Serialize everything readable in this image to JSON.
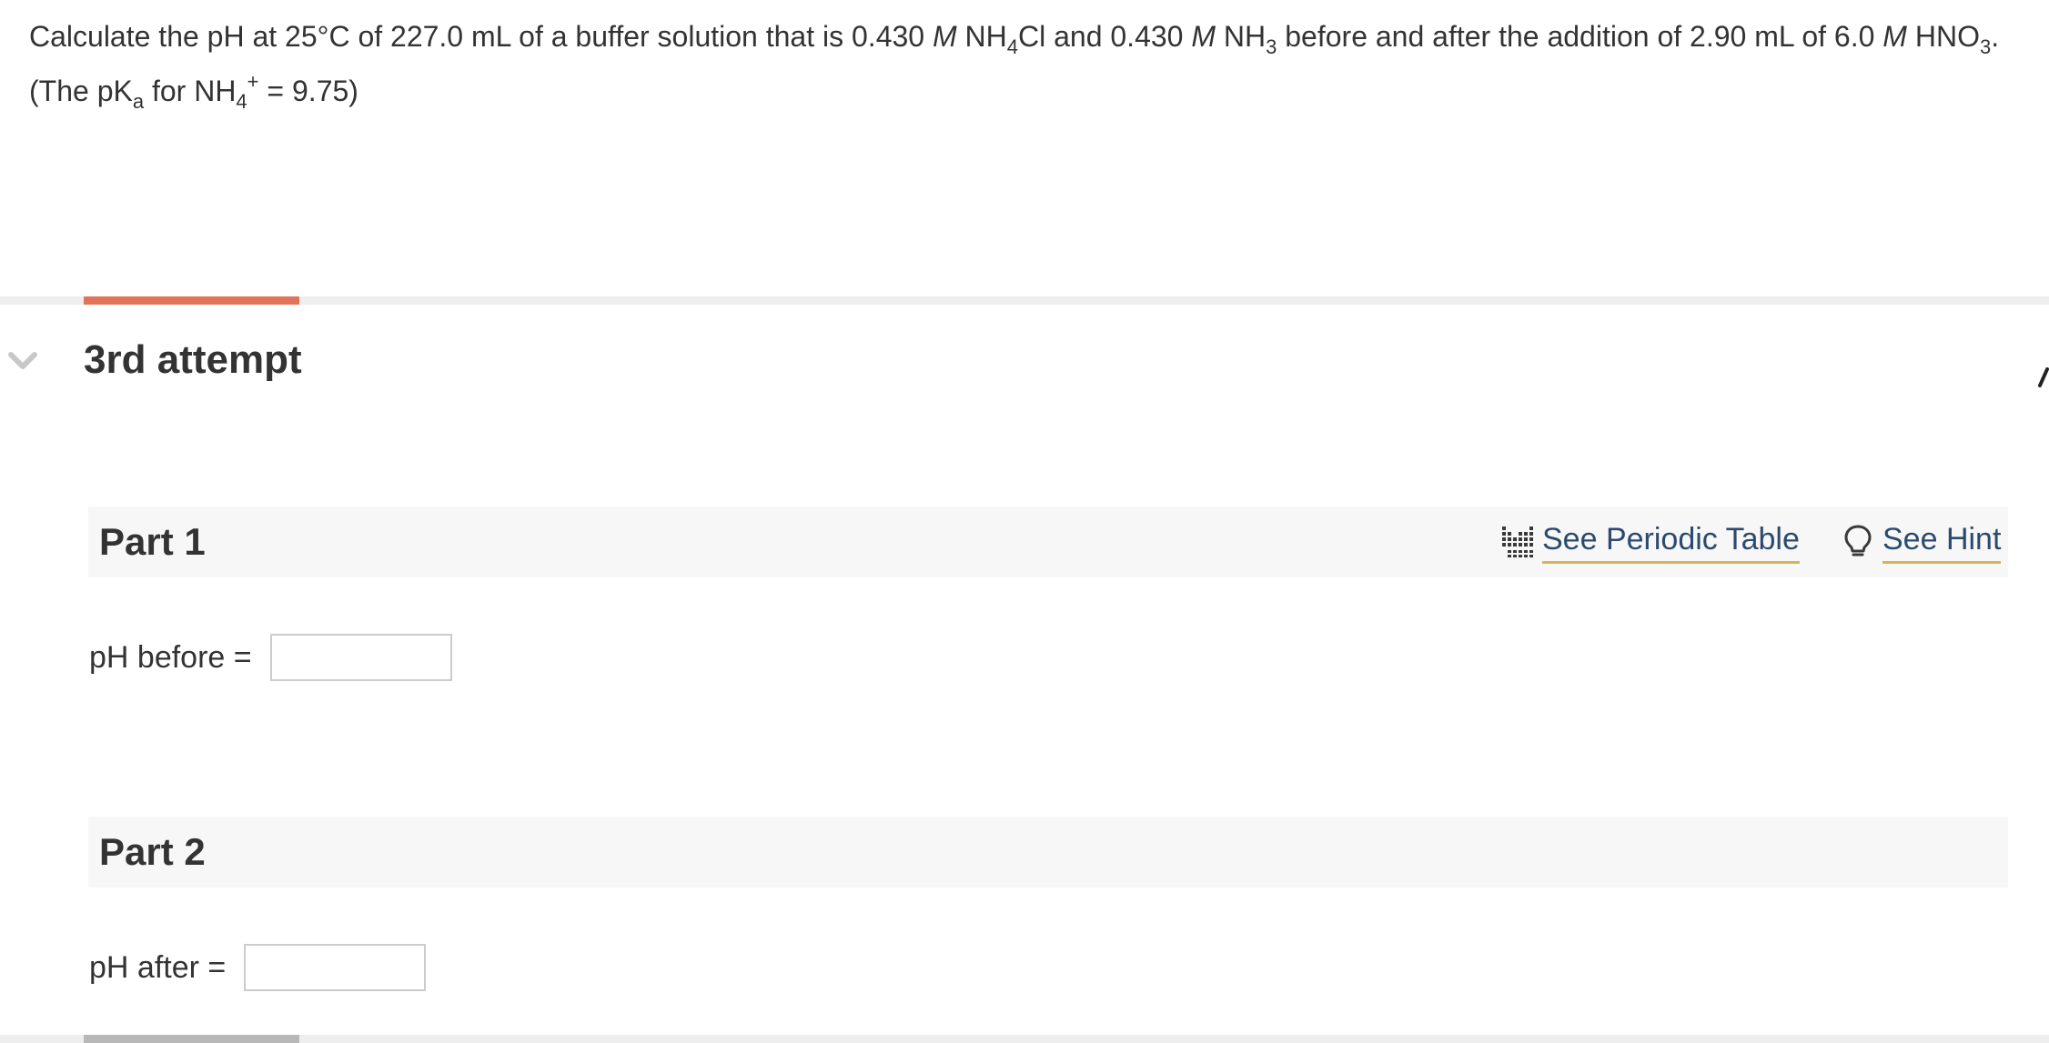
{
  "question": {
    "t1": "Calculate the pH at 25°C of 227.0 mL of a buffer solution that is 0.430 ",
    "m1": "M",
    "t2": " NH",
    "s1": "4",
    "t3": "Cl and 0.430 ",
    "m2": "M",
    "t4": " NH",
    "s2": "3",
    "t5": " before and after the addition of 2.90 mL of 6.0 ",
    "m3": "M",
    "t6": " HNO",
    "s3": "3",
    "t7": ". (The pK",
    "s4": "a",
    "t8": " for NH",
    "s5": "4",
    "sup1": "+",
    "t9": " = 9.75)"
  },
  "attempt": {
    "title": "3rd attempt",
    "progress_fraction": 0.105
  },
  "colors": {
    "accent": "#e07358",
    "link_underline": "#d7b556",
    "link_text": "#2b4a6f",
    "bottom_progress": "#b8b8b8"
  },
  "tools": {
    "periodic_label": "See Periodic Table",
    "periodic_icon": "periodic-table-icon",
    "hint_label": "See Hint",
    "hint_icon": "lightbulb-icon"
  },
  "parts": [
    {
      "title": "Part 1",
      "answer_label": "pH before =",
      "answer_value": ""
    },
    {
      "title": "Part 2",
      "answer_label": "pH after =",
      "answer_value": ""
    }
  ]
}
